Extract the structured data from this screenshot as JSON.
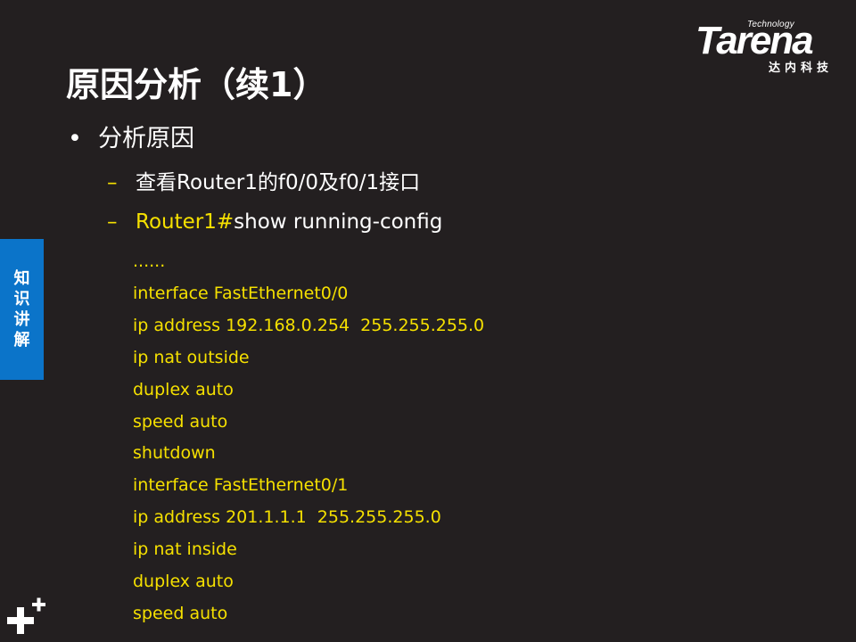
{
  "logo": {
    "tech": "Technology",
    "word": "Tarena",
    "cn": "达内科技"
  },
  "title": "原因分析（续1）",
  "bullet1": "分析原因",
  "sub1": "查看Router1的f0/0及f0/1接口",
  "sub2": {
    "prompt": "Router1#",
    "command": "show running-config"
  },
  "config_lines": [
    "......",
    "interface FastEthernet0/0",
    "ip address 192.168.0.254  255.255.255.0",
    "ip nat outside",
    "duplex auto",
    "speed auto",
    "shutdown",
    "interface FastEthernet0/1",
    "ip address 201.1.1.1  255.255.255.0",
    "ip nat inside",
    "duplex auto",
    "speed auto"
  ],
  "side_tab": [
    "知",
    "识",
    "讲",
    "解"
  ],
  "colors": {
    "background": "#231f20",
    "accent_yellow": "#f5e000",
    "tab_blue": "#0b74c9",
    "text": "#ffffff"
  },
  "icons": {
    "bottom_left": "plus-icon"
  }
}
